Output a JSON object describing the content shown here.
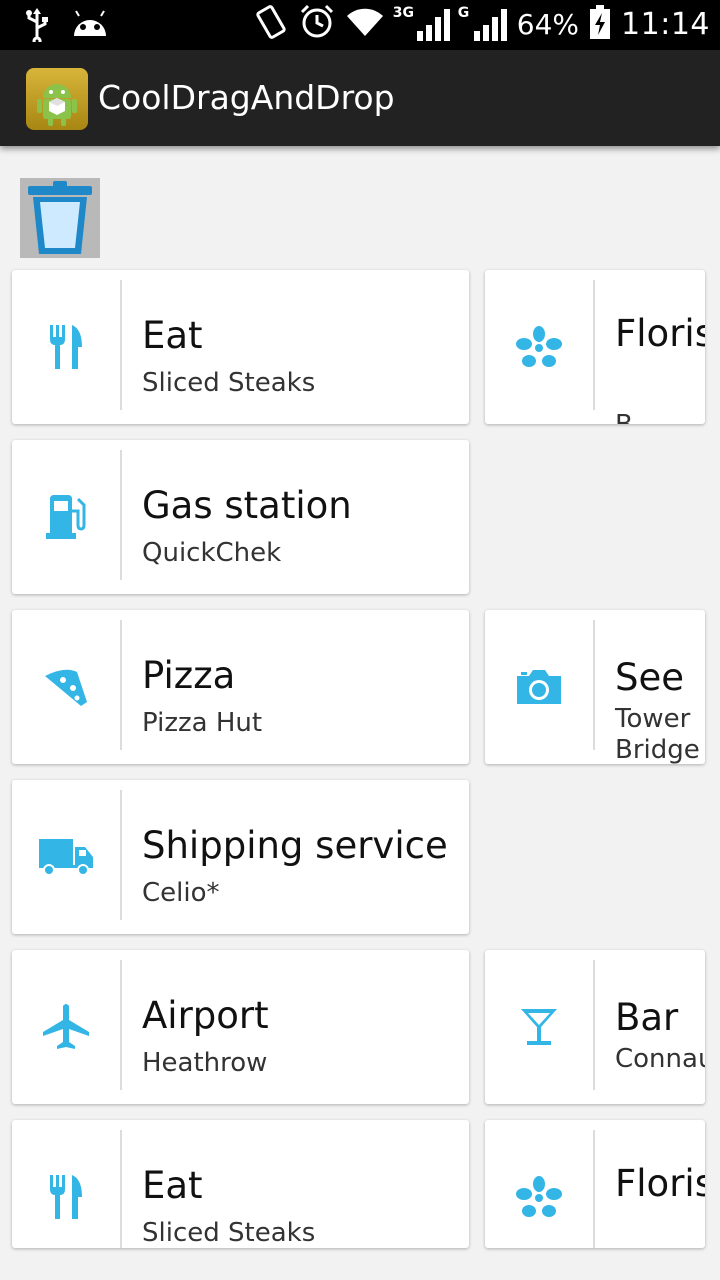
{
  "status_bar": {
    "net1_label": "3G",
    "net2_label": "G",
    "battery": "64%",
    "time": "11:14"
  },
  "app": {
    "title": "CoolDragAndDrop"
  },
  "accent_color": "#33b5e5",
  "cards": [
    {
      "title": "Eat",
      "subtitle": "Sliced Steaks",
      "icon": "fork-knife-icon"
    },
    {
      "title": "Florist",
      "subtitle": "B...",
      "icon": "flower-icon"
    },
    {
      "title": "Gas station",
      "subtitle": "QuickChek",
      "icon": "gas-pump-icon"
    },
    {
      "title": "Pizza",
      "subtitle": "Pizza Hut",
      "icon": "pizza-icon"
    },
    {
      "title": "See",
      "subtitle": "Tower Bridge",
      "icon": "camera-icon"
    },
    {
      "title": "Shipping service",
      "subtitle": "Celio*",
      "icon": "truck-icon"
    },
    {
      "title": "Airport",
      "subtitle": "Heathrow",
      "icon": "airplane-icon"
    },
    {
      "title": "Bar",
      "subtitle": "Connaught",
      "icon": "cocktail-icon"
    },
    {
      "title": "Eat",
      "subtitle": "Sliced Steaks",
      "icon": "fork-knife-icon"
    },
    {
      "title": "Florist",
      "subtitle": "",
      "icon": "flower-icon"
    }
  ]
}
